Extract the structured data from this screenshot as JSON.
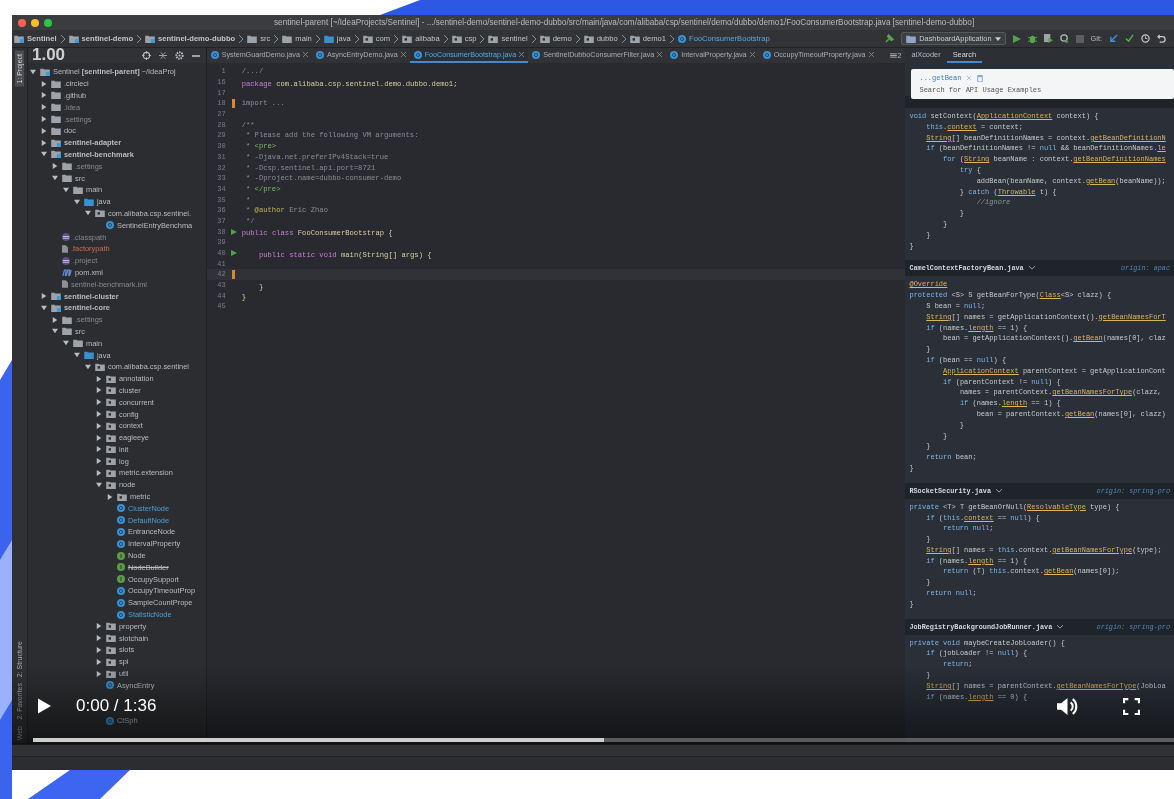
{
  "window": {
    "title": "sentinel-parent [~/IdeaProjects/Sentinel] - .../sentinel-demo/sentinel-demo-dubbo/src/main/java/com/alibaba/csp/sentinel/demo/dubbo/demo1/FooConsumerBootstrap.java [sentinel-demo-dubbo]"
  },
  "breadcrumbs": [
    {
      "label": "Sentinel",
      "kind": "module"
    },
    {
      "label": "sentinel-demo",
      "kind": "module"
    },
    {
      "label": "sentinel-demo-dubbo",
      "kind": "module"
    },
    {
      "label": "src",
      "kind": "folder"
    },
    {
      "label": "main",
      "kind": "folder"
    },
    {
      "label": "java",
      "kind": "source-folder"
    },
    {
      "label": "com",
      "kind": "package"
    },
    {
      "label": "alibaba",
      "kind": "package"
    },
    {
      "label": "csp",
      "kind": "package"
    },
    {
      "label": "sentinel",
      "kind": "package"
    },
    {
      "label": "demo",
      "kind": "package"
    },
    {
      "label": "dubbo",
      "kind": "package"
    },
    {
      "label": "demo1",
      "kind": "package"
    },
    {
      "label": "FooConsumerBootstrap",
      "kind": "class"
    }
  ],
  "toolbar": {
    "run_config": "DashboardApplication",
    "git_label": "Git:"
  },
  "side_tabs": [
    {
      "label": "1: Project",
      "selected": true
    },
    {
      "label": "2: Structure",
      "selected": false
    },
    {
      "label": "2: Favorites",
      "selected": false
    },
    {
      "label": "Web",
      "selected": false
    }
  ],
  "speed_badge": "1.00",
  "project_tree": [
    {
      "label": "Sentinel **[sentinel-parent]** ~/IdeaProj",
      "kind": "module",
      "expanded": true,
      "children": [
        {
          "label": ".circleci",
          "kind": "folder",
          "expanded": false
        },
        {
          "label": ".github",
          "kind": "folder",
          "expanded": false
        },
        {
          "label": ".idea",
          "kind": "folder",
          "expanded": false,
          "ignored": true
        },
        {
          "label": ".settings",
          "kind": "folder",
          "expanded": false,
          "ignored": true
        },
        {
          "label": "doc",
          "kind": "folder",
          "expanded": false
        },
        {
          "label": "sentinel-adapter",
          "kind": "module",
          "expanded": false
        },
        {
          "label": "sentinel-benchmark",
          "kind": "module",
          "expanded": true,
          "children": [
            {
              "label": ".settings",
              "kind": "folder",
              "expanded": false,
              "ignored": true
            },
            {
              "label": "src",
              "kind": "folder",
              "expanded": true,
              "children": [
                {
                  "label": "main",
                  "kind": "folder",
                  "expanded": true,
                  "children": [
                    {
                      "label": "java",
                      "kind": "source-folder",
                      "expanded": true,
                      "children": [
                        {
                          "label": "com.alibaba.csp.sentinel.",
                          "kind": "package",
                          "expanded": true,
                          "children": [
                            {
                              "label": "SentinelEntryBenchma",
                              "kind": "class"
                            }
                          ]
                        }
                      ]
                    }
                  ]
                }
              ]
            },
            {
              "label": ".classpath",
              "kind": "eclipse-file",
              "ignored": true
            },
            {
              "label": ".factorypath",
              "kind": "file",
              "unversioned": true
            },
            {
              "label": ".project",
              "kind": "eclipse-file",
              "ignored": true
            },
            {
              "label": "pom.xml",
              "kind": "maven-file"
            },
            {
              "label": "sentinel-benchmark.iml",
              "kind": "file",
              "ignored": true
            }
          ]
        },
        {
          "label": "sentinel-cluster",
          "kind": "module",
          "expanded": false
        },
        {
          "label": "sentinel-core",
          "kind": "module",
          "expanded": true,
          "children": [
            {
              "label": ".settings",
              "kind": "folder",
              "expanded": false,
              "ignored": true
            },
            {
              "label": "src",
              "kind": "folder",
              "expanded": true,
              "children": [
                {
                  "label": "main",
                  "kind": "folder",
                  "expanded": true,
                  "children": [
                    {
                      "label": "java",
                      "kind": "source-folder",
                      "expanded": true,
                      "children": [
                        {
                          "label": "com.alibaba.csp.sentinel",
                          "kind": "package",
                          "expanded": true,
                          "children": [
                            {
                              "label": "annotation",
                              "kind": "package",
                              "expanded": false
                            },
                            {
                              "label": "cluster",
                              "kind": "package",
                              "expanded": false
                            },
                            {
                              "label": "concurrent",
                              "kind": "package",
                              "expanded": false
                            },
                            {
                              "label": "config",
                              "kind": "package",
                              "expanded": false
                            },
                            {
                              "label": "context",
                              "kind": "package",
                              "expanded": false
                            },
                            {
                              "label": "eagleeye",
                              "kind": "package",
                              "expanded": false
                            },
                            {
                              "label": "init",
                              "kind": "package",
                              "expanded": false
                            },
                            {
                              "label": "log",
                              "kind": "package",
                              "expanded": false
                            },
                            {
                              "label": "metric.extension",
                              "kind": "package",
                              "expanded": false
                            },
                            {
                              "label": "node",
                              "kind": "package",
                              "expanded": true,
                              "children": [
                                {
                                  "label": "metric",
                                  "kind": "package",
                                  "expanded": false
                                },
                                {
                                  "label": "ClusterNode",
                                  "kind": "class",
                                  "modified": true
                                },
                                {
                                  "label": "DefaultNode",
                                  "kind": "class",
                                  "modified": true
                                },
                                {
                                  "label": "EntranceNode",
                                  "kind": "class"
                                },
                                {
                                  "label": "IntervalProperty",
                                  "kind": "class"
                                },
                                {
                                  "label": "Node",
                                  "kind": "interface"
                                },
                                {
                                  "label": "NodeBuilder",
                                  "kind": "interface",
                                  "deprecated": true
                                },
                                {
                                  "label": "OccupySupport",
                                  "kind": "interface"
                                },
                                {
                                  "label": "OccupyTimeoutProp",
                                  "kind": "class"
                                },
                                {
                                  "label": "SampleCountPrope",
                                  "kind": "class"
                                },
                                {
                                  "label": "StatisticNode",
                                  "kind": "class",
                                  "modified": true
                                }
                              ]
                            },
                            {
                              "label": "property",
                              "kind": "package",
                              "expanded": false
                            },
                            {
                              "label": "slotchain",
                              "kind": "package",
                              "expanded": false
                            },
                            {
                              "label": "slots",
                              "kind": "package",
                              "expanded": false
                            },
                            {
                              "label": "spi",
                              "kind": "package",
                              "expanded": false
                            },
                            {
                              "label": "util",
                              "kind": "package",
                              "expanded": false
                            },
                            {
                              "label": "AsyncEntry",
                              "kind": "class"
                            },
                            {
                              "covered": true
                            },
                            {
                              "covered": true
                            },
                            {
                              "label": "CtSph",
                              "kind": "class"
                            }
                          ]
                        }
                      ]
                    }
                  ]
                }
              ]
            }
          ]
        }
      ]
    }
  ],
  "editor_tabs": [
    {
      "label": "SystemGuardDemo.java",
      "selected": false
    },
    {
      "label": "AsyncEntryDemo.java",
      "selected": false
    },
    {
      "label": "FooConsumerBootstrap.java",
      "selected": true
    },
    {
      "label": "SentinelDubboConsumerFilter.java",
      "selected": false
    },
    {
      "label": "IntervalProperty.java",
      "selected": false
    },
    {
      "label": "OccupyTimeoutProperty.java",
      "selected": false
    }
  ],
  "tab_overflow": "2",
  "code_lines": [
    {
      "number": "1",
      "text": "/.../",
      "kind": "folded"
    },
    {
      "number": "16",
      "text": "package com.alibaba.csp.sentinel.demo.dubbo.demo1;",
      "kind": "code"
    },
    {
      "number": "17"
    },
    {
      "number": "18",
      "text": "import ...",
      "kind": "folded",
      "changed": true
    },
    {
      "number": "27"
    },
    {
      "number": "28",
      "text": "/**",
      "kind": "doc"
    },
    {
      "number": "29",
      "text": " * Please add the following VM arguments:",
      "kind": "doc"
    },
    {
      "number": "30",
      "text": " * <pre>",
      "kind": "doc"
    },
    {
      "number": "31",
      "text": " * -Djava.net.preferIPv4Stack=true",
      "kind": "doc"
    },
    {
      "number": "32",
      "text": " * -Dcsp.sentinel.api.port=8721",
      "kind": "doc"
    },
    {
      "number": "33",
      "text": " * -Dproject.name=dubbo-consumer-demo",
      "kind": "doc"
    },
    {
      "number": "34",
      "text": " * </pre>",
      "kind": "doc"
    },
    {
      "number": "35",
      "text": " *",
      "kind": "doc"
    },
    {
      "number": "36",
      "text": " * @author Eric Zhao",
      "kind": "doc"
    },
    {
      "number": "37",
      "text": " */",
      "kind": "doc"
    },
    {
      "number": "38",
      "text": "public class FooConsumerBootstrap {",
      "kind": "code",
      "runnable": true
    },
    {
      "number": "39"
    },
    {
      "number": "40",
      "text": "    public static void main(String[] args) {",
      "kind": "code",
      "runnable": true
    },
    {
      "number": "41"
    },
    {
      "number": "42",
      "changed": true
    },
    {
      "number": "43",
      "text": "    }",
      "kind": "code"
    },
    {
      "number": "44",
      "text": "}",
      "kind": "code"
    },
    {
      "number": "45"
    }
  ],
  "right_tabs": [
    {
      "label": "aiXcoder",
      "selected": false
    },
    {
      "label": "Search",
      "selected": true
    }
  ],
  "search_popup": {
    "query": "...getBean",
    "placeholder": "Search for API Usage Examples"
  },
  "snippets": [
    {
      "lines": [
        [
          "void setContext(",
          {
            "link": "ApplicationContext"
          },
          " context) {"
        ],
        [
          "    this.",
          {
            "link": "context"
          },
          " = context;"
        ],
        [
          {
            "link": "    String"
          },
          "[] beanDefinitionNames = context.",
          {
            "link": "getBeanDefinitionN"
          }
        ],
        [
          "    if (beanDefinitionNames != null && beanDefinitionNames.",
          {
            "link": "le"
          }
        ],
        [
          "        for (",
          {
            "link": "String"
          },
          " beanName : context.",
          {
            "link": "getBeanDefinitionNames"
          }
        ],
        [
          "            try {"
        ],
        [
          "                addBean(beanName, context.",
          {
            "link": "getBean"
          },
          "(beanName));"
        ],
        [
          "            } catch (",
          {
            "link": "Throwable"
          },
          " t) {"
        ],
        [
          "                //ignore"
        ],
        [
          "            }"
        ],
        [
          "        }"
        ],
        [
          "    }"
        ],
        [
          "}"
        ]
      ]
    },
    {
      "file": "CamelContextFactoryBean.java",
      "origin": "origin: apac",
      "lines": [
        [
          {
            "link": "@Override"
          }
        ],
        [
          "protected <S> S getBeanForType(",
          {
            "link": "Class"
          },
          "<S> clazz) {"
        ],
        [
          "    S bean = null;"
        ],
        [
          {
            "link": "    String"
          },
          "[] names = getApplicationContext().",
          {
            "link": "getBeanNamesForT"
          }
        ],
        [
          "    if (names.",
          {
            "link": "length"
          },
          " == 1) {"
        ],
        [
          "        bean = getApplicationContext().",
          {
            "link": "getBean"
          },
          "(names[0], claz"
        ],
        [
          "    }"
        ],
        [
          "    if (bean == null) {"
        ],
        [
          {
            "link": "        ApplicationContext"
          },
          " parentContext = getApplicationCont"
        ],
        [
          "        if (parentContext != null) {"
        ],
        [
          "            names = parentContext.",
          {
            "link": "getBeanNamesForType"
          },
          "(clazz,"
        ],
        [
          "            if (names.",
          {
            "link": "length"
          },
          " == 1) {"
        ],
        [
          "                bean = parentContext.",
          {
            "link": "getBean"
          },
          "(names[0], clazz)"
        ],
        [
          "            }"
        ],
        [
          "        }"
        ],
        [
          "    }"
        ],
        [
          "    return bean;"
        ],
        [
          "}"
        ]
      ]
    },
    {
      "file": "RSocketSecurity.java",
      "origin": "origin: spring-pro",
      "lines": [
        [
          "private <T> T getBeanOrNull(",
          {
            "link": "ResolvableType"
          },
          " type) {"
        ],
        [
          "    if (this.",
          {
            "link": "context"
          },
          " == null) {"
        ],
        [
          "        return null;"
        ],
        [
          "    }"
        ],
        [
          {
            "link": "    String"
          },
          "[] names = this.context.",
          {
            "link": "getBeanNamesForType"
          },
          "(type);"
        ],
        [
          "    if (names.",
          {
            "link": "length"
          },
          " == 1) {"
        ],
        [
          "        return (T) this.context.",
          {
            "link": "getBean"
          },
          "(names[0]);"
        ],
        [
          "    }"
        ],
        [
          "    return null;"
        ],
        [
          "}"
        ]
      ]
    },
    {
      "file": "JobRegistryBackgroundJobRunner.java",
      "origin": "origin: spring-pro",
      "lines": [
        [
          "private void maybeCreateJobLoader() {"
        ],
        [
          "    if (jobLoader != null) {"
        ],
        [
          "        return;"
        ],
        [
          "    }"
        ],
        [
          {
            "link": "    String"
          },
          "[] names = parentContext.",
          {
            "link": "getBeanNamesForType"
          },
          "(JobLoa"
        ],
        [
          "    if (names.",
          {
            "link": "length"
          },
          " == 0) {"
        ]
      ]
    }
  ],
  "player": {
    "time": "0:00 / 1:36",
    "buffer": {
      "level": 0.5
    }
  }
}
